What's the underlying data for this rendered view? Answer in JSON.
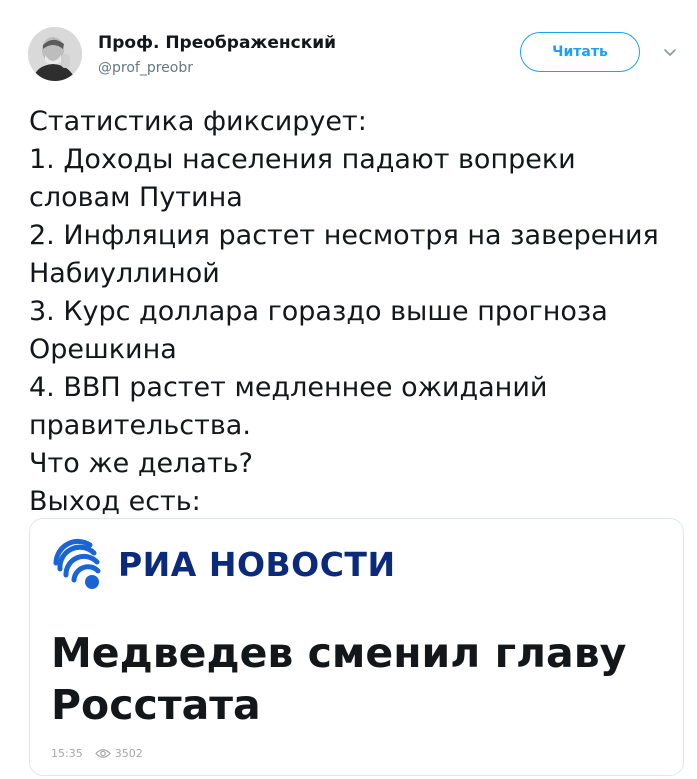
{
  "author": {
    "name": "Проф. Преображенский",
    "handle": "@prof_preobr",
    "avatar_icon": "portrait-avatar"
  },
  "follow_button": {
    "label": "Читать"
  },
  "menu_icon": "chevron-down-icon",
  "tweet": {
    "lines": [
      "Статистика фиксирует:",
      "1. Доходы населения падают вопреки",
      "словам Путина",
      "2. Инфляция растет несмотря на заверения",
      "Набиуллиной",
      "3. Курс доллара гораздо выше прогноза",
      "Орешкина",
      "4. ВВП растет медленнее ожиданий",
      "правительства.",
      "Что же делать?",
      "Выход есть:"
    ]
  },
  "card": {
    "source": "РИА НОВОСТИ",
    "source_logo_icon": "ria-novosti-logo",
    "headline_lines": [
      "Медведев сменил главу",
      "Росстата"
    ],
    "time": "15:35",
    "views": "3502",
    "views_icon": "eye-icon",
    "brand_color": "#0c2a7c",
    "logo_color": "#1a65d6"
  },
  "colors": {
    "accent": "#1da1f2",
    "text": "#14171a",
    "muted": "#657786"
  }
}
